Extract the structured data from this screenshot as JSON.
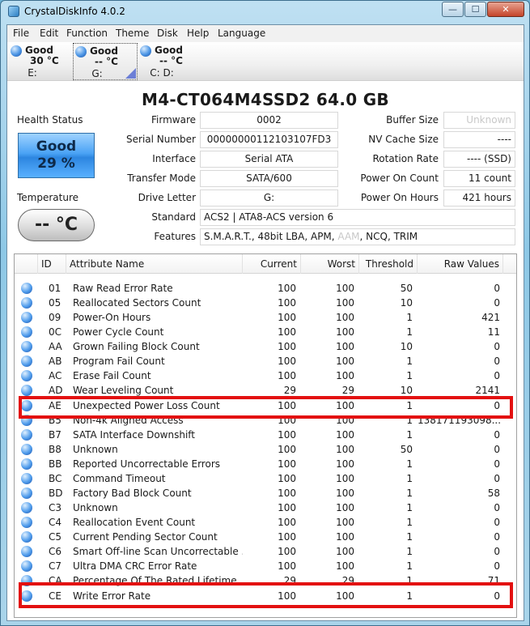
{
  "window": {
    "title": "CrystalDiskInfo 4.0.2",
    "min_glyph": "—",
    "max_glyph": "☐",
    "close_glyph": "✕"
  },
  "menu": [
    "File",
    "Edit",
    "Function",
    "Theme",
    "Disk",
    "Help",
    "Language"
  ],
  "drives": [
    {
      "health": "Good",
      "temp": "30 °C",
      "letter": "E:"
    },
    {
      "health": "Good",
      "temp": "-- °C",
      "letter": "G:"
    },
    {
      "health": "Good",
      "temp": "-- °C",
      "letter": "C: D:"
    }
  ],
  "model": "M4-CT064M4SSD2  64.0 GB",
  "health": {
    "label": "Health Status",
    "status": "Good",
    "percent": "29 %",
    "temp_label": "Temperature",
    "temp_value": "-- °C"
  },
  "info": {
    "firmware_label": "Firmware",
    "firmware": "0002",
    "serial_label": "Serial Number",
    "serial": "00000000112103107FD3",
    "interface_label": "Interface",
    "interface": "Serial ATA",
    "transfer_label": "Transfer Mode",
    "transfer": "SATA/600",
    "letter_label": "Drive Letter",
    "letter": "G:",
    "standard_label": "Standard",
    "standard": "ACS2 | ATA8-ACS version 6",
    "features_label": "Features",
    "features_pre": "S.M.A.R.T., 48bit LBA, APM, ",
    "features_aam": "AAM",
    "features_post": ", NCQ, TRIM",
    "buffer_label": "Buffer Size",
    "buffer": "Unknown",
    "nvcache_label": "NV Cache Size",
    "nvcache": "----",
    "rotation_label": "Rotation Rate",
    "rotation": "---- (SSD)",
    "poweron_count_label": "Power On Count",
    "poweron_count": "11 count",
    "poweron_hours_label": "Power On Hours",
    "poweron_hours": "421 hours"
  },
  "table": {
    "headers": [
      "ID",
      "Attribute Name",
      "Current",
      "Worst",
      "Threshold",
      "Raw Values"
    ],
    "rows": [
      {
        "id": "01",
        "name": "Raw Read Error Rate",
        "cur": "100",
        "worst": "100",
        "thr": "50",
        "raw": "0"
      },
      {
        "id": "05",
        "name": "Reallocated Sectors Count",
        "cur": "100",
        "worst": "100",
        "thr": "10",
        "raw": "0"
      },
      {
        "id": "09",
        "name": "Power-On Hours",
        "cur": "100",
        "worst": "100",
        "thr": "1",
        "raw": "421"
      },
      {
        "id": "0C",
        "name": "Power Cycle Count",
        "cur": "100",
        "worst": "100",
        "thr": "1",
        "raw": "11"
      },
      {
        "id": "AA",
        "name": "Grown Failing Block Count",
        "cur": "100",
        "worst": "100",
        "thr": "10",
        "raw": "0"
      },
      {
        "id": "AB",
        "name": "Program Fail Count",
        "cur": "100",
        "worst": "100",
        "thr": "1",
        "raw": "0"
      },
      {
        "id": "AC",
        "name": "Erase Fail Count",
        "cur": "100",
        "worst": "100",
        "thr": "1",
        "raw": "0"
      },
      {
        "id": "AD",
        "name": "Wear Leveling Count",
        "cur": "29",
        "worst": "29",
        "thr": "10",
        "raw": "2141"
      },
      {
        "id": "AE",
        "name": "Unexpected Power Loss Count",
        "cur": "100",
        "worst": "100",
        "thr": "1",
        "raw": "0"
      },
      {
        "id": "B5",
        "name": "Non-4k Aligned Access",
        "cur": "100",
        "worst": "100",
        "thr": "1",
        "raw": "138171193098..."
      },
      {
        "id": "B7",
        "name": "SATA Interface Downshift",
        "cur": "100",
        "worst": "100",
        "thr": "1",
        "raw": "0"
      },
      {
        "id": "B8",
        "name": "Unknown",
        "cur": "100",
        "worst": "100",
        "thr": "50",
        "raw": "0"
      },
      {
        "id": "BB",
        "name": "Reported Uncorrectable Errors",
        "cur": "100",
        "worst": "100",
        "thr": "1",
        "raw": "0"
      },
      {
        "id": "BC",
        "name": "Command Timeout",
        "cur": "100",
        "worst": "100",
        "thr": "1",
        "raw": "0"
      },
      {
        "id": "BD",
        "name": "Factory Bad Block Count",
        "cur": "100",
        "worst": "100",
        "thr": "1",
        "raw": "58"
      },
      {
        "id": "C3",
        "name": "Unknown",
        "cur": "100",
        "worst": "100",
        "thr": "1",
        "raw": "0"
      },
      {
        "id": "C4",
        "name": "Reallocation Event Count",
        "cur": "100",
        "worst": "100",
        "thr": "1",
        "raw": "0"
      },
      {
        "id": "C5",
        "name": "Current Pending Sector Count",
        "cur": "100",
        "worst": "100",
        "thr": "1",
        "raw": "0"
      },
      {
        "id": "C6",
        "name": "Smart Off-line Scan Uncorrectable ...",
        "cur": "100",
        "worst": "100",
        "thr": "1",
        "raw": "0"
      },
      {
        "id": "C7",
        "name": "Ultra DMA CRC Error Rate",
        "cur": "100",
        "worst": "100",
        "thr": "1",
        "raw": "0"
      },
      {
        "id": "CA",
        "name": "Percentage Of The Rated Lifetime ...",
        "cur": "29",
        "worst": "29",
        "thr": "1",
        "raw": "71"
      },
      {
        "id": "CE",
        "name": "Write Error Rate",
        "cur": "100",
        "worst": "100",
        "thr": "1",
        "raw": "0"
      }
    ]
  },
  "colors": {
    "highlight": "#e31010",
    "health_good": "#4aa3f5"
  }
}
